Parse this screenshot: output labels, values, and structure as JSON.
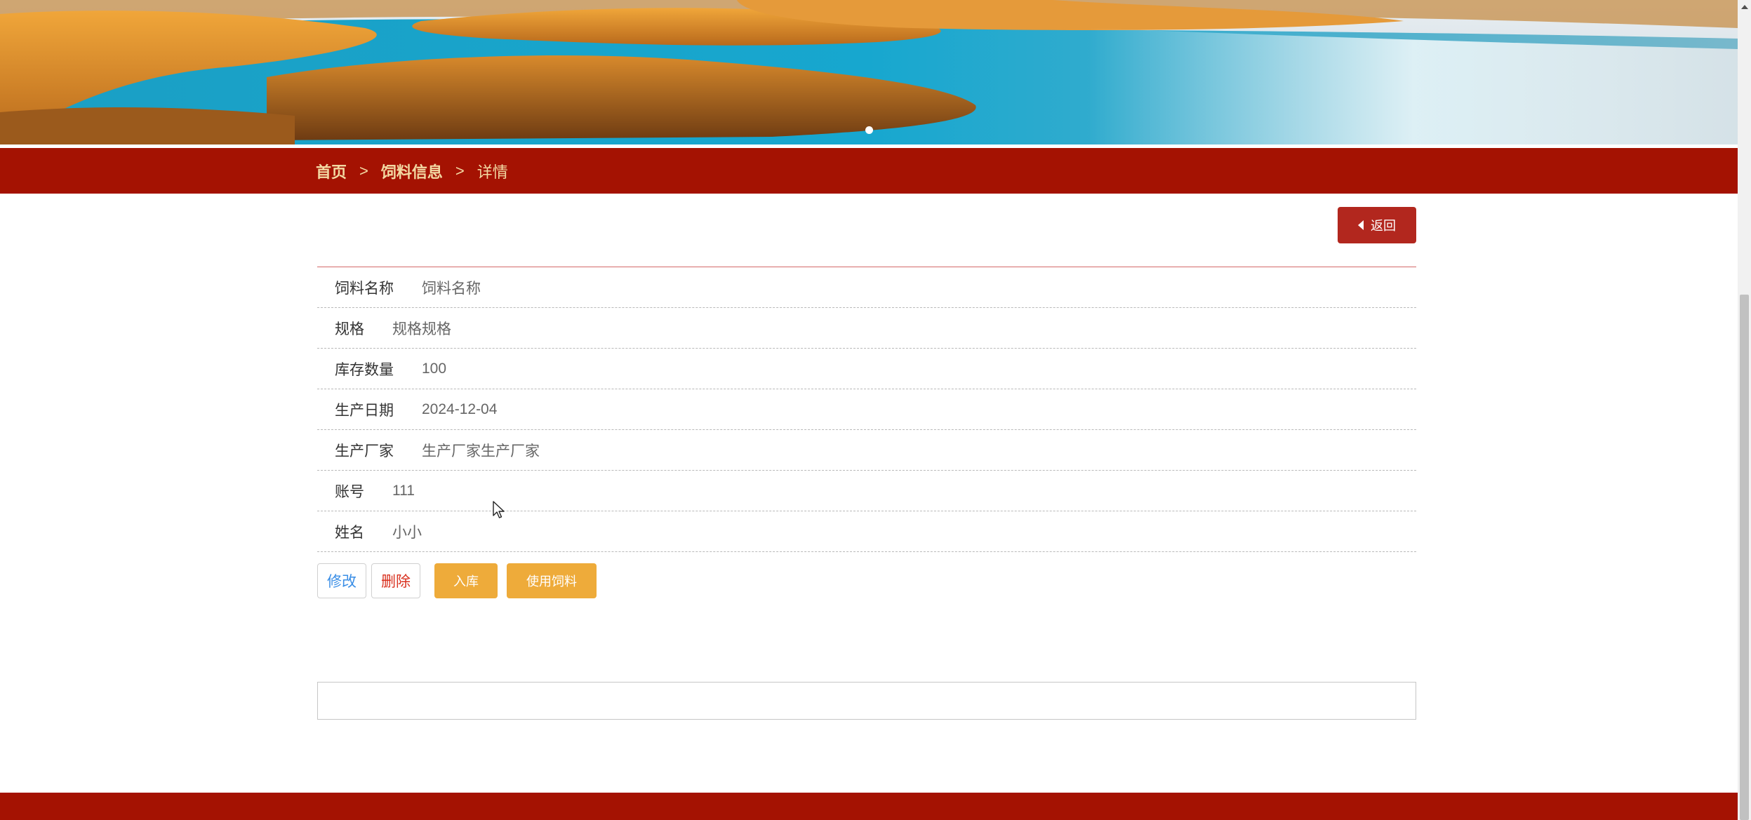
{
  "breadcrumb": {
    "home": "首页",
    "separator": ">",
    "section": "饲料信息",
    "current": "详情"
  },
  "back_button": {
    "label": "返回"
  },
  "details": [
    {
      "label": "饲料名称",
      "value": "饲料名称"
    },
    {
      "label": "规格",
      "value": "规格规格"
    },
    {
      "label": "库存数量",
      "value": "100"
    },
    {
      "label": "生产日期",
      "value": "2024-12-04"
    },
    {
      "label": "生产厂家",
      "value": "生产厂家生产厂家"
    },
    {
      "label": "账号",
      "value": "111"
    },
    {
      "label": "姓名",
      "value": "小小"
    }
  ],
  "actions": {
    "edit": "修改",
    "delete": "删除",
    "stock_in": "入库",
    "use_feed": "使用饲料"
  },
  "colors": {
    "primary_red": "#a41202",
    "back_button": "#b2271e",
    "accent_orange": "#eeab3a",
    "breadcrumb_text": "#f3d9a3",
    "edit_blue": "#3a8ee6",
    "delete_red": "#d9301e"
  },
  "carousel": {
    "slides": 1,
    "active_index": 0
  }
}
